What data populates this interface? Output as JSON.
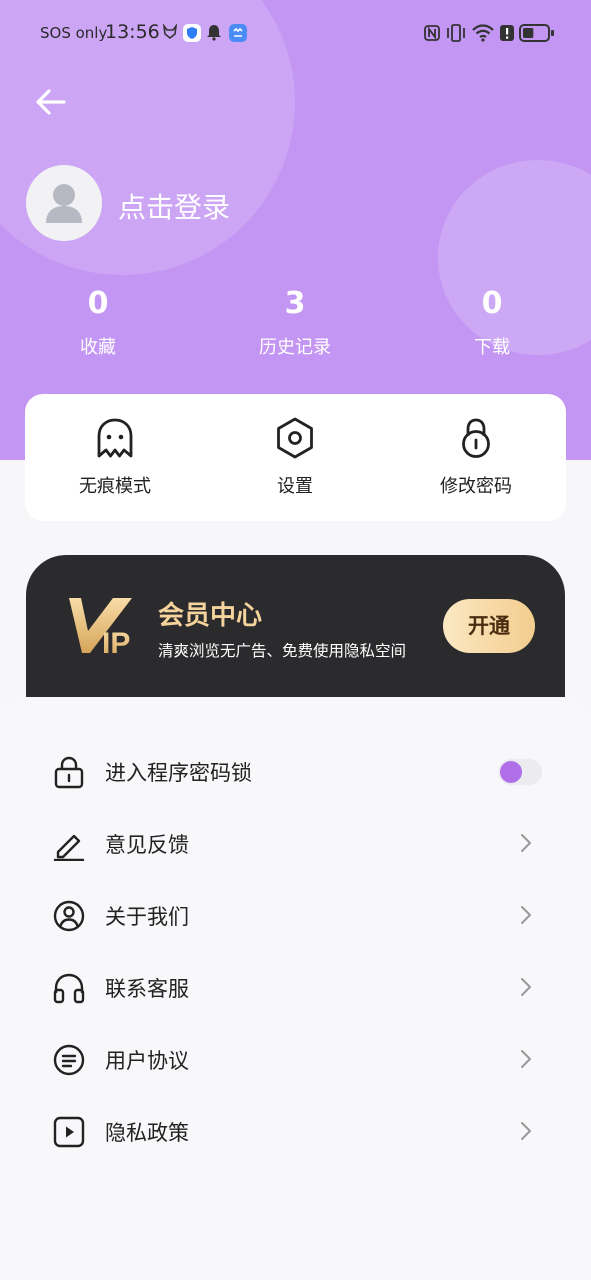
{
  "status_bar": {
    "carrier": "SOS only",
    "time": "13:56",
    "battery_level": 0.45
  },
  "profile": {
    "login_text": "点击登录"
  },
  "stats": [
    {
      "count": "0",
      "label": "收藏"
    },
    {
      "count": "3",
      "label": "历史记录"
    },
    {
      "count": "0",
      "label": "下载"
    }
  ],
  "quick_actions": [
    {
      "label": "无痕模式",
      "icon": "ghost-icon"
    },
    {
      "label": "设置",
      "icon": "settings-hex-icon"
    },
    {
      "label": "修改密码",
      "icon": "lock-icon"
    }
  ],
  "vip": {
    "logo_text": "IP",
    "title": "会员中心",
    "subtitle": "清爽浏览无广告、免费使用隐私空间",
    "button": "开通",
    "title_color": "#f5d39c"
  },
  "menu": [
    {
      "label": "进入程序密码锁",
      "icon": "lock-icon",
      "control": "toggle",
      "toggle_on": false
    },
    {
      "label": "意见反馈",
      "icon": "pen-icon",
      "control": "chevron"
    },
    {
      "label": "关于我们",
      "icon": "user-circle-icon",
      "control": "chevron"
    },
    {
      "label": "联系客服",
      "icon": "headset-icon",
      "control": "chevron"
    },
    {
      "label": "用户协议",
      "icon": "document-circle-icon",
      "control": "chevron"
    },
    {
      "label": "隐私政策",
      "icon": "play-square-icon",
      "control": "chevron"
    }
  ],
  "colors": {
    "header": "#c396f3",
    "accent": "#b06ee9",
    "vip_card": "#2b2a2c"
  }
}
